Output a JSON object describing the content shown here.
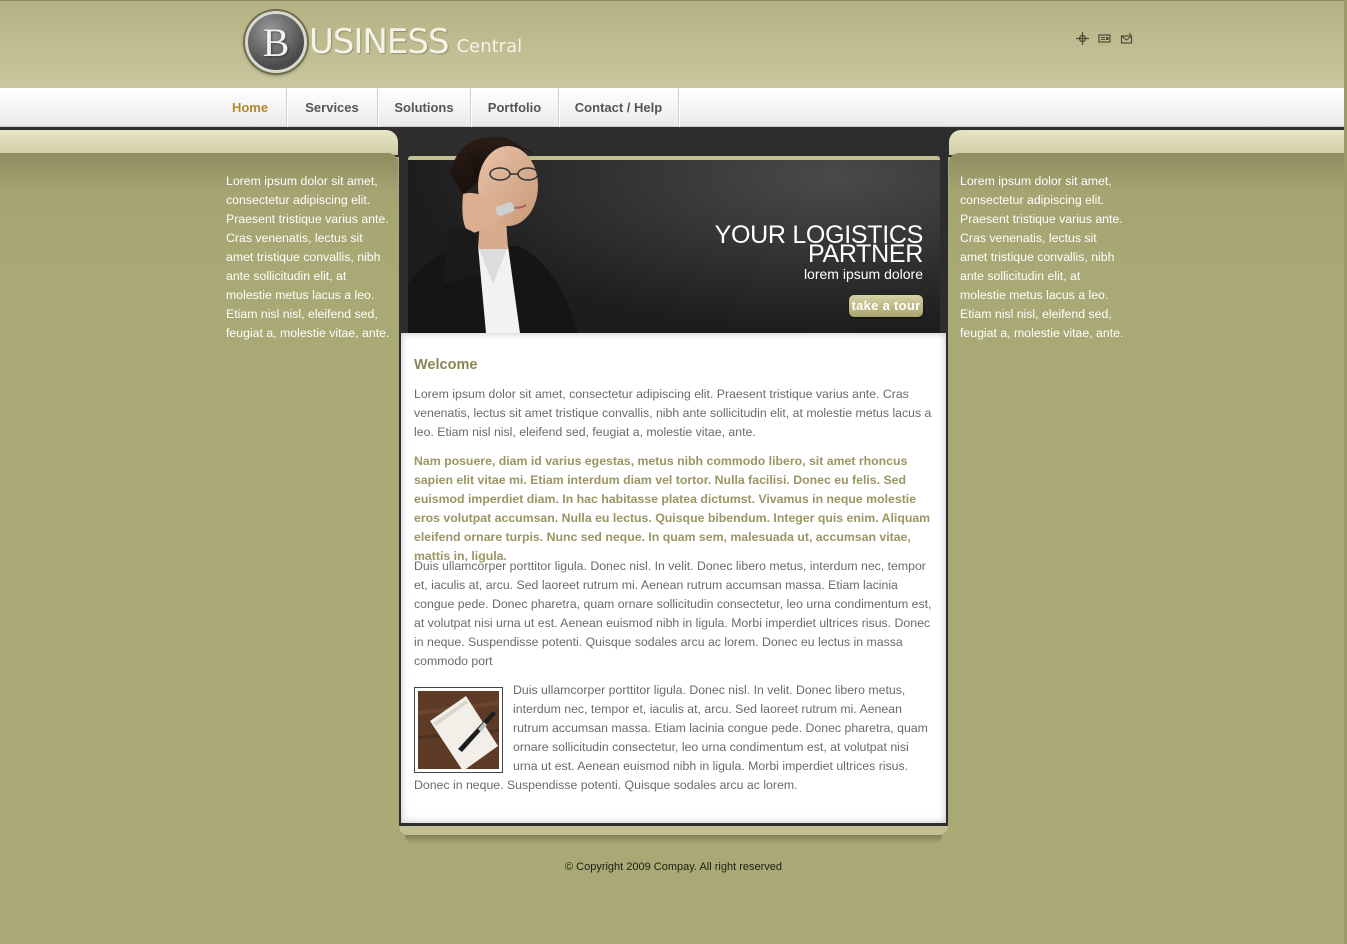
{
  "header": {
    "logo_letter": "B",
    "logo_word": "USINESS",
    "logo_sub": "Central",
    "util_icons": [
      "sitemap-icon",
      "contact-card-icon",
      "mail-icon"
    ]
  },
  "nav": {
    "items": [
      {
        "label": "Home",
        "active": true
      },
      {
        "label": "Services",
        "active": false
      },
      {
        "label": "Solutions",
        "active": false
      },
      {
        "label": "Portfolio",
        "active": false
      },
      {
        "label": "Contact / Help",
        "active": false
      }
    ]
  },
  "sidebar_left": {
    "text": "Lorem ipsum dolor sit amet, consectetur adipiscing elit. Praesent tristique varius ante. Cras venenatis, lectus sit amet tristique convallis, nibh ante sollicitudin elit, at molestie metus lacus a leo. Etiam nisl nisl, eleifend sed, feugiat a, molestie vitae, ante."
  },
  "sidebar_right": {
    "text": "Lorem ipsum dolor sit amet, consectetur adipiscing elit. Praesent tristique varius ante. Cras venenatis, lectus sit amet tristique convallis, nibh ante sollicitudin elit, at molestie metus lacus a leo. Etiam nisl nisl, eleifend sed, feugiat a, molestie vitae, ante."
  },
  "banner": {
    "title_line1": "YOUR LOGISTICS",
    "title_line2": "PARTNER",
    "subtitle": "lorem ipsum dolore",
    "button": "take a tour"
  },
  "content": {
    "heading": "Welcome",
    "p1": "Lorem ipsum dolor sit amet, consectetur adipiscing elit. Praesent tristique varius ante. Cras venenatis, lectus sit amet tristique convallis, nibh ante sollicitudin elit, at molestie metus lacus a leo. Etiam nisl nisl, eleifend sed, feugiat a, molestie vitae, ante.",
    "p2": "Nam posuere, diam id varius egestas, metus nibh commodo libero, sit amet rhoncus sapien elit vitae mi. Etiam interdum diam vel tortor. Nulla facilisi. Donec eu felis. Sed euismod imperdiet diam. In hac habitasse platea dictumst. Vivamus in neque molestie eros volutpat accumsan. Nulla eu lectus. Quisque bibendum. Integer quis enim. Aliquam eleifend ornare turpis. Nunc sed neque. In quam sem, malesuada ut, accumsan vitae, mattis in, ligula.",
    "p3": "Duis ullamcorper porttitor ligula. Donec nisl. In velit. Donec libero metus, interdum nec, tempor et, iaculis at, arcu. Sed laoreet rutrum mi. Aenean rutrum accumsan massa. Etiam lacinia congue pede. Donec pharetra, quam ornare sollicitudin consectetur, leo urna condimentum est, at volutpat nisi urna ut est. Aenean euismod nibh in ligula. Morbi imperdiet ultrices risus. Donec in neque. Suspendisse potenti. Quisque sodales arcu ac lorem. Donec eu lectus in massa commodo port",
    "p4": "Duis ullamcorper porttitor ligula. Donec nisl. In velit. Donec libero metus, interdum nec, tempor et, iaculis at, arcu. Sed laoreet rutrum mi. Aenean rutrum accumsan massa. Etiam lacinia congue pede. Donec pharetra, quam ornare sollicitudin consectetur, leo urna condimentum est, at volutpat nisi urna ut est. Aenean euismod nibh in ligula. Morbi imperdiet ultrices risus. Donec in neque. Suspendisse potenti. Quisque sodales arcu ac lorem."
  },
  "footer": {
    "copyright": "© Copyright 2009 Compay. All right reserved"
  }
}
